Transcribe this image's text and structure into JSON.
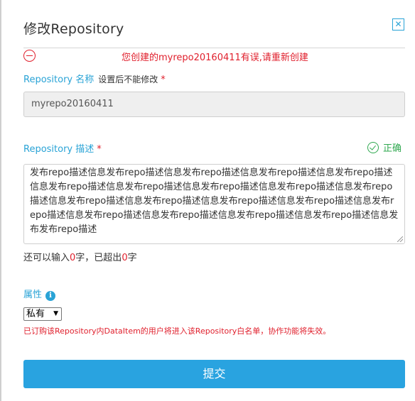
{
  "dialog": {
    "title": "修改Repository",
    "close_icon": "close-icon"
  },
  "error": {
    "icon": "minus-circle-icon",
    "message": "您创建的myrepo20160411有误,请重新创建"
  },
  "name_field": {
    "label": "Repository 名称",
    "hint": "设置后不能修改",
    "required_mark": "*",
    "value": "myrepo20160411"
  },
  "desc_field": {
    "label": "Repository 描述",
    "required_mark": "*",
    "status_icon": "check-circle-icon",
    "status_text": "正确",
    "value": "发布repo描述信息发布repo描述信息发布repo描述信息发布repo描述信息发布repo描述信息发布repo描述信息发布repo描述信息发布repo描述信息发布repo描述信息发布repo描述信息发布repo描述信息发布repo描述信息发布repo描述信息发布repo描述信息发布repo描述信息发布repo描述信息发布repo描述信息发布repo描述信息发布repo描述信息发布发布repo描述"
  },
  "counter": {
    "prefix": "还可以输入",
    "remaining": "0",
    "middle": "字，已超出",
    "exceeded": "0",
    "suffix": "字"
  },
  "property": {
    "label": "属性",
    "info_icon": "info-icon",
    "selected": "私有",
    "warning": "已订购该Repository内DataItem的用户将进入该Repository白名单，协作功能将失效。"
  },
  "submit": {
    "label": "提交"
  },
  "colors": {
    "accent": "#29a3d6",
    "error": "#e0202d",
    "success": "#2fa84f",
    "button": "#29a3e0"
  }
}
